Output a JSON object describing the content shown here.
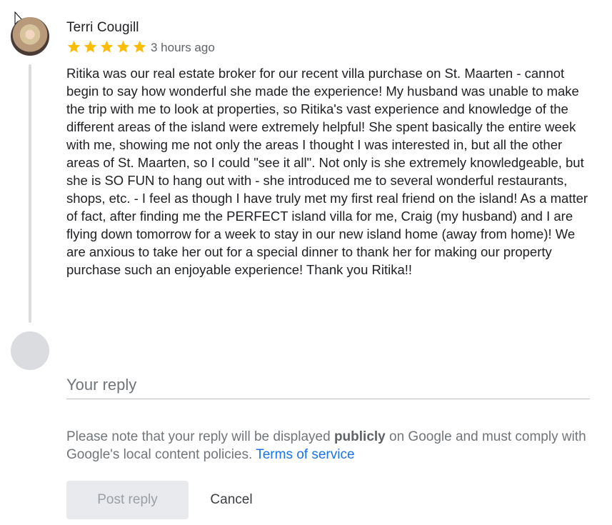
{
  "review": {
    "reviewer_name": "Terri Cougill",
    "rating": 5,
    "rating_max": 5,
    "timestamp": "3 hours ago",
    "text": "Ritika was our real estate broker for our recent villa purchase on St. Maarten - cannot begin to say how wonderful she made the experience! My husband was unable to make the trip with me to look at properties, so Ritika's vast experience and knowledge of the different areas of the island were extremely helpful! She spent basically the entire week with me, showing me not only the areas I thought I was interested in, but all the other areas of St. Maarten, so I could \"see it all\". Not only is she extremely knowledgeable, but she is SO FUN to hang out with - she introduced me to several wonderful restaurants, shops, etc. - I feel as though I have truly met my first real friend on the island! As a matter of fact, after finding me the PERFECT island villa for me, Craig (my husband) and I are flying down tomorrow for a week to stay in our new island home (away from home)! We are anxious to take her out for a special dinner to thank her for making our property purchase such an enjoyable experience! Thank you Ritika!!"
  },
  "reply": {
    "placeholder": "Your reply",
    "value": "",
    "note_before": "Please note that your reply will be displayed ",
    "note_bold": "publicly",
    "note_after": " on Google and must comply with Google's local content policies. ",
    "terms_link": "Terms of service",
    "post_label": "Post reply",
    "cancel_label": "Cancel"
  },
  "icons": {
    "star": "star-icon",
    "cursor": "mouse-pointer-icon"
  },
  "colors": {
    "star": "#fbbc04",
    "link": "#1a73e8",
    "muted_text": "#70757a",
    "disabled_button_bg": "#e8eaed"
  }
}
